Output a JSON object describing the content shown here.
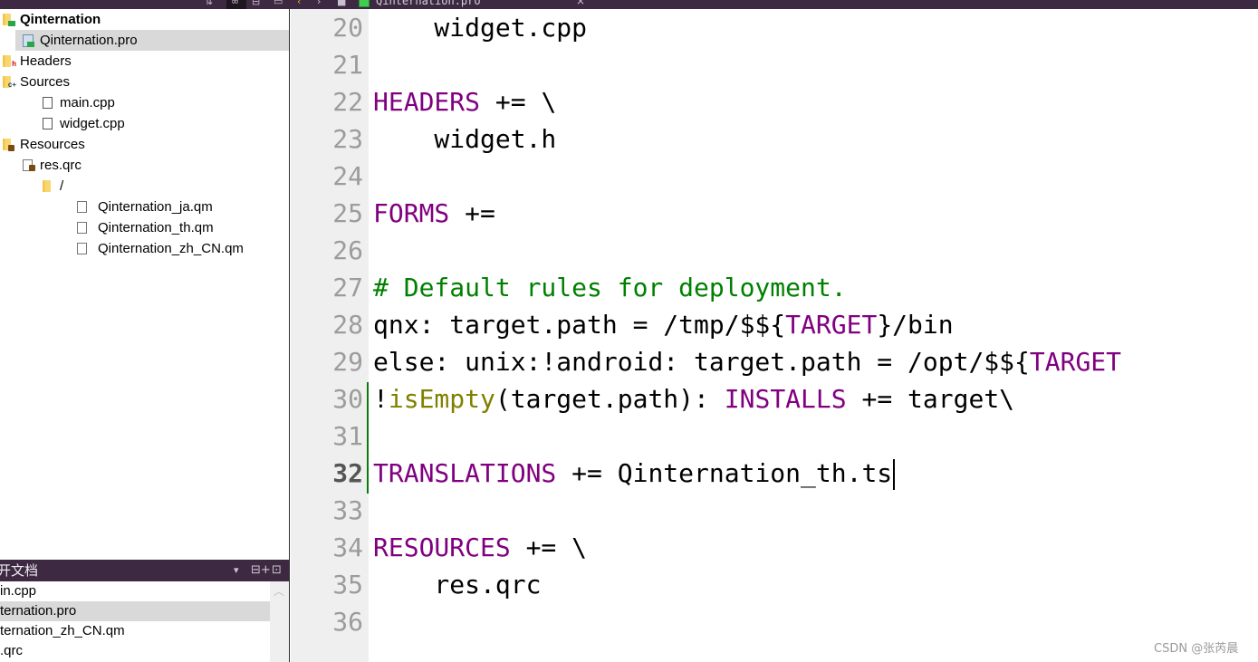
{
  "toolbar": {
    "document_title": "Qinternation.pro",
    "icons": [
      "sync-icon",
      "link-icon",
      "split-icon",
      "close-panel-icon",
      "back-icon",
      "forward-icon",
      "lock-icon",
      "qt-project-icon",
      "close-icon"
    ]
  },
  "project_tree": {
    "items": [
      {
        "label": "Qinternation",
        "icon": "qt-project-folder-icon",
        "level": 0,
        "bold": true,
        "arrow": ""
      },
      {
        "label": "Qinternation.pro",
        "icon": "pro-file-icon",
        "level": 1,
        "selected": true,
        "arrow": ""
      },
      {
        "label": "Headers",
        "icon": "headers-folder-icon",
        "level": 0,
        "arrow": "collapsed"
      },
      {
        "label": "Sources",
        "icon": "sources-folder-icon",
        "level": 0,
        "arrow": "expanded"
      },
      {
        "label": "main.cpp",
        "icon": "cpp-file-icon",
        "level": 2,
        "arrow": ""
      },
      {
        "label": "widget.cpp",
        "icon": "cpp-file-icon",
        "level": 2,
        "arrow": ""
      },
      {
        "label": "Resources",
        "icon": "resources-folder-icon",
        "level": 0,
        "arrow": "expanded"
      },
      {
        "label": "res.qrc",
        "icon": "qrc-file-icon",
        "level": 1,
        "arrow": "expanded"
      },
      {
        "label": "/",
        "icon": "folder-icon",
        "level": 2,
        "arrow": "expanded"
      },
      {
        "label": "Qinternation_ja.qm",
        "icon": "file-icon",
        "level": 3,
        "arrow": ""
      },
      {
        "label": "Qinternation_th.qm",
        "icon": "file-icon",
        "level": 3,
        "arrow": ""
      },
      {
        "label": "Qinternation_zh_CN.qm",
        "icon": "file-icon",
        "level": 3,
        "arrow": ""
      }
    ]
  },
  "open_documents": {
    "title": "开文档",
    "items": [
      {
        "label": "in.cpp",
        "selected": false
      },
      {
        "label": "ternation.pro",
        "selected": true
      },
      {
        "label": "ternation_zh_CN.qm",
        "selected": false
      },
      {
        "label": ".qrc",
        "selected": false
      }
    ]
  },
  "editor": {
    "current_line": 32,
    "lines": [
      {
        "no": "20",
        "tokens": [
          {
            "t": "    widget.cpp",
            "c": ""
          }
        ]
      },
      {
        "no": "21",
        "tokens": []
      },
      {
        "no": "22",
        "tokens": [
          {
            "t": "HEADERS",
            "c": "kw"
          },
          {
            "t": " += \\",
            "c": ""
          }
        ]
      },
      {
        "no": "23",
        "tokens": [
          {
            "t": "    widget.h",
            "c": ""
          }
        ]
      },
      {
        "no": "24",
        "tokens": []
      },
      {
        "no": "25",
        "tokens": [
          {
            "t": "FORMS",
            "c": "kw"
          },
          {
            "t": " +=",
            "c": ""
          }
        ]
      },
      {
        "no": "26",
        "tokens": []
      },
      {
        "no": "27",
        "tokens": [
          {
            "t": "# Default rules for deployment.",
            "c": "cm"
          }
        ]
      },
      {
        "no": "28",
        "tokens": [
          {
            "t": "qnx: target.path = /tmp/$${",
            "c": ""
          },
          {
            "t": "TARGET",
            "c": "kw"
          },
          {
            "t": "}/bin",
            "c": ""
          }
        ]
      },
      {
        "no": "29",
        "tokens": [
          {
            "t": "else: unix:!android: target.path = /opt/$${",
            "c": ""
          },
          {
            "t": "TARGET",
            "c": "kw"
          }
        ]
      },
      {
        "no": "30",
        "tokens": [
          {
            "t": "!",
            "c": ""
          },
          {
            "t": "isEmpty",
            "c": "fn"
          },
          {
            "t": "(target.path): ",
            "c": ""
          },
          {
            "t": "INSTALLS",
            "c": "kw"
          },
          {
            "t": " += target\\",
            "c": ""
          }
        ]
      },
      {
        "no": "31",
        "tokens": []
      },
      {
        "no": "32",
        "tokens": [
          {
            "t": "TRANSLATIONS",
            "c": "kw"
          },
          {
            "t": " += Qinternation_th.ts",
            "c": ""
          }
        ],
        "cursor": true
      },
      {
        "no": "33",
        "tokens": []
      },
      {
        "no": "34",
        "tokens": [
          {
            "t": "RESOURCES",
            "c": "kw"
          },
          {
            "t": " += \\",
            "c": ""
          }
        ]
      },
      {
        "no": "35",
        "tokens": [
          {
            "t": "    res.qrc",
            "c": ""
          }
        ]
      },
      {
        "no": "36",
        "tokens": []
      }
    ],
    "changed_lines": [
      "30",
      "31",
      "32"
    ]
  },
  "watermark": "CSDN @张芮晨",
  "colors": {
    "toolbar_bg": "#3d2a42",
    "keyword": "#800080",
    "comment": "#008000",
    "function": "#808000",
    "change_marker": "#0a7a0a",
    "selection": "#d9d9d9"
  }
}
